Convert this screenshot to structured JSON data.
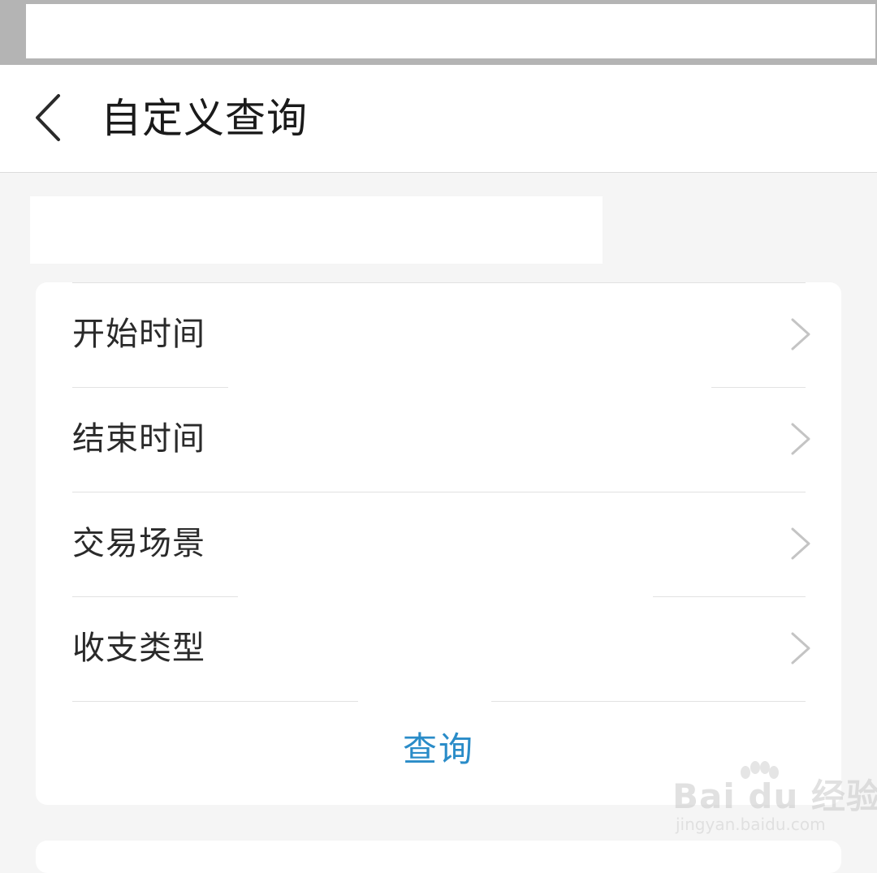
{
  "header": {
    "title": "自定义查询",
    "back_icon": "chevron-left-icon"
  },
  "filter": {
    "rows": [
      {
        "label": "开始时间",
        "icon": "chevron-right-icon"
      },
      {
        "label": "结束时间",
        "icon": "chevron-right-icon"
      },
      {
        "label": "交易场景",
        "icon": "chevron-right-icon"
      },
      {
        "label": "收支类型",
        "icon": "chevron-right-icon"
      }
    ],
    "query_label": "查询"
  },
  "colors": {
    "accent": "#2a8cc8",
    "background": "#f5f5f5",
    "card": "#ffffff",
    "title_text": "#1a1a1a",
    "label_text": "#2a2a2a",
    "chevron": "#c4c4c4"
  },
  "watermark": {
    "main": "Bai du 经验",
    "sub": "jingyan.baidu.com"
  }
}
